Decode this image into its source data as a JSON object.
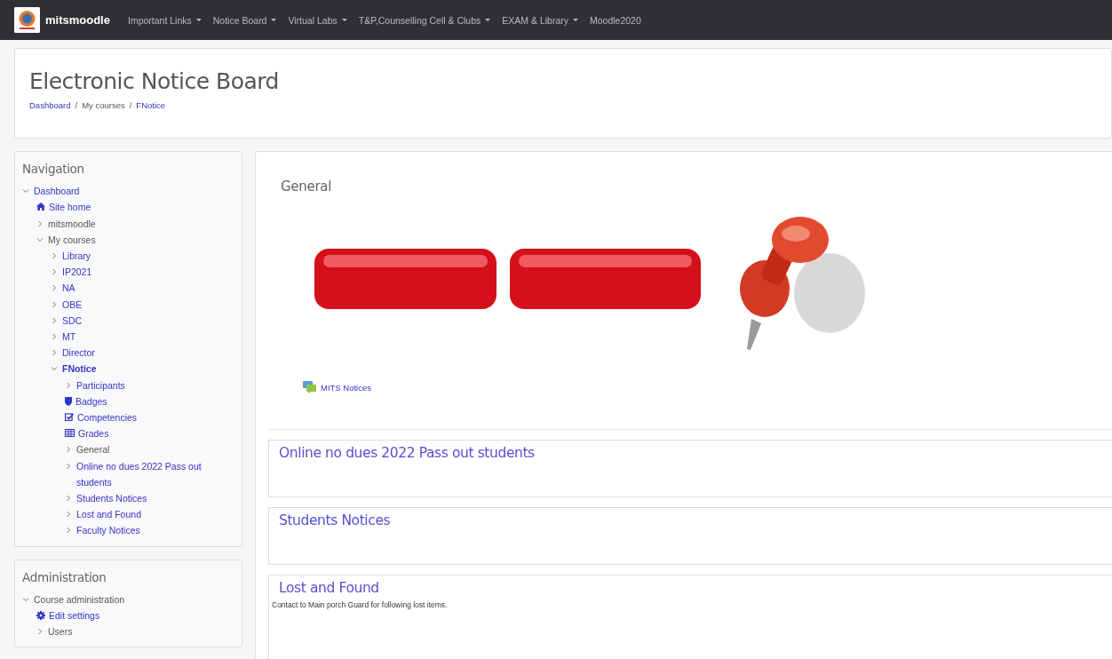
{
  "navbar": {
    "brand": "mitsmoodle",
    "menu": [
      {
        "label": "Important Links",
        "dropdown": true
      },
      {
        "label": "Notice Board",
        "dropdown": true
      },
      {
        "label": "Virtual Labs",
        "dropdown": true
      },
      {
        "label": "T&P,Counselling Cell & Clubs",
        "dropdown": true
      },
      {
        "label": "EXAM & Library",
        "dropdown": true
      },
      {
        "label": "Moodle2020",
        "dropdown": false
      }
    ]
  },
  "header": {
    "title": "Electronic Notice Board",
    "separator": "/",
    "breadcrumb": [
      {
        "label": "Dashboard",
        "link": true
      },
      {
        "label": "My courses",
        "link": false
      },
      {
        "label": "FNotice",
        "link": true
      }
    ]
  },
  "navigation": {
    "title": "Navigation",
    "tree": [
      {
        "label": "Dashboard",
        "kind": "branch",
        "expanded": true,
        "link": true,
        "children": [
          {
            "label": "Site home",
            "kind": "home",
            "link": true
          },
          {
            "label": "mitsmoodle",
            "kind": "branch",
            "expanded": false,
            "link": false
          },
          {
            "label": "My courses",
            "kind": "branch",
            "expanded": true,
            "link": false,
            "children": [
              {
                "label": "Library",
                "kind": "branch",
                "expanded": false,
                "link": true,
                "current": false
              },
              {
                "label": "IP2021",
                "kind": "branch",
                "expanded": false,
                "link": true,
                "current": false
              },
              {
                "label": "NA",
                "kind": "branch",
                "expanded": false,
                "link": true,
                "current": false
              },
              {
                "label": "OBE",
                "kind": "branch",
                "expanded": false,
                "link": true,
                "current": false
              },
              {
                "label": "SDC",
                "kind": "branch",
                "expanded": false,
                "link": true,
                "current": false
              },
              {
                "label": "MT",
                "kind": "branch",
                "expanded": false,
                "link": true,
                "current": false
              },
              {
                "label": "Director",
                "kind": "branch",
                "expanded": false,
                "link": true,
                "current": false
              },
              {
                "label": "FNotice",
                "kind": "branch",
                "expanded": true,
                "link": true,
                "current": true,
                "children": [
                  {
                    "label": "Participants",
                    "kind": "branch",
                    "expanded": false,
                    "link": true
                  },
                  {
                    "label": "Badges",
                    "kind": "badges",
                    "link": true
                  },
                  {
                    "label": "Competencies",
                    "kind": "competencies",
                    "link": true
                  },
                  {
                    "label": "Grades",
                    "kind": "grades",
                    "link": true
                  },
                  {
                    "label": "General",
                    "kind": "branch",
                    "expanded": false,
                    "link": false
                  },
                  {
                    "label": "Online no dues 2022 Pass out students",
                    "kind": "branch",
                    "expanded": false,
                    "link": true
                  },
                  {
                    "label": "Students Notices",
                    "kind": "branch",
                    "expanded": false,
                    "link": true
                  },
                  {
                    "label": "Lost and Found",
                    "kind": "branch",
                    "expanded": false,
                    "link": true
                  },
                  {
                    "label": "Faculty Notices",
                    "kind": "branch",
                    "expanded": false,
                    "link": true
                  }
                ]
              }
            ]
          }
        ]
      }
    ]
  },
  "administration": {
    "title": "Administration",
    "tree": [
      {
        "label": "Course administration",
        "kind": "branch",
        "expanded": true,
        "link": false,
        "children": [
          {
            "label": "Edit settings",
            "kind": "settings",
            "link": true
          },
          {
            "label": "Users",
            "kind": "branch",
            "expanded": false,
            "link": false
          }
        ]
      }
    ]
  },
  "course": {
    "general": {
      "title": "General",
      "activities": [
        {
          "label": "MITS Notices"
        }
      ]
    },
    "sections": [
      {
        "title": "Online no dues 2022 Pass out students"
      },
      {
        "title": "Students Notices"
      },
      {
        "title": "Lost and Found",
        "summary": "Contact to Main porch Guard for following lost items."
      }
    ]
  }
}
